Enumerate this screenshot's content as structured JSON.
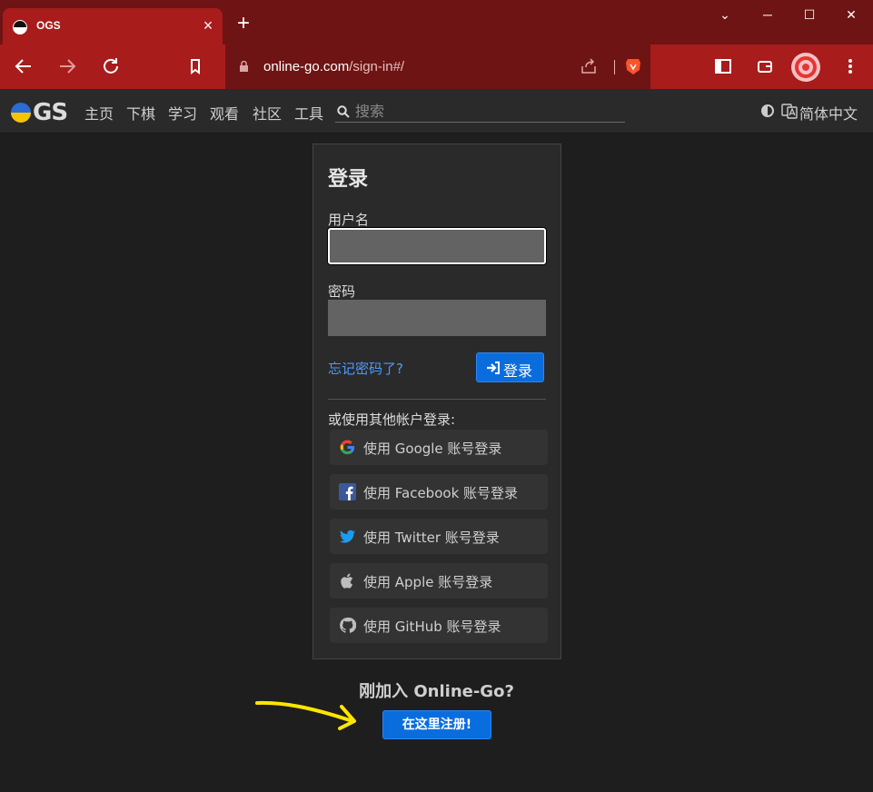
{
  "browser": {
    "tab_title": "OGS",
    "tab_close": "×",
    "new_tab": "+",
    "url_host": "online-go.com",
    "url_path": "/sign-in#/",
    "window_minimize": "⌄",
    "window_min": "─",
    "window_max": "☐",
    "window_close": "✕"
  },
  "navbar": {
    "logo_text": "GS",
    "items": [
      "主页",
      "下棋",
      "学习",
      "观看",
      "社区",
      "工具"
    ],
    "search_placeholder": "搜索",
    "language": "简体中文"
  },
  "login": {
    "title": "登录",
    "username_label": "用户名",
    "username_value": "",
    "password_label": "密码",
    "password_value": "",
    "forgot_link": "忘记密码了?",
    "login_button": "登录",
    "alt_label": "或使用其他帐户登录:",
    "social": [
      {
        "icon": "google-icon",
        "label": "使用 Google 账号登录"
      },
      {
        "icon": "facebook-icon",
        "label": "使用 Facebook 账号登录"
      },
      {
        "icon": "twitter-icon",
        "label": "使用 Twitter 账号登录"
      },
      {
        "icon": "apple-icon",
        "label": "使用 Apple 账号登录"
      },
      {
        "icon": "github-icon",
        "label": "使用 GitHub 账号登录"
      }
    ]
  },
  "signup": {
    "prompt": "刚加入 Online-Go?",
    "button": "在这里注册!"
  },
  "colors": {
    "tabbar": "#6e1414",
    "toolbar": "#a81c1c",
    "page_bg": "#1e1e1e",
    "primary_button": "#0a6dde",
    "link": "#4c9bff",
    "annotation_arrow": "#ffe600"
  }
}
